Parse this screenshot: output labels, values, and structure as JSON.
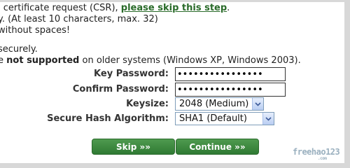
{
  "intro": {
    "line1_prefix": "l certificate request (CSR), ",
    "skip_link": "please skip this step",
    "line1_suffix": ".",
    "line2": "y. (At least 10 characters, max. 32)",
    "line3": "without spaces!",
    "line4": "securely.",
    "line5_prefix": "e ",
    "line5_bold": "not supported",
    "line5_suffix": " on older systems (Windows XP, Windows 2003)."
  },
  "form": {
    "key_password_label": "Key Password:",
    "key_password_value": "••••••••••••••••",
    "confirm_password_label": "Confirm Password:",
    "confirm_password_value": "••••••••••••••••",
    "keysize_label": "Keysize:",
    "keysize_value": "2048 (Medium)",
    "hash_label": "Secure Hash Algorithm:",
    "hash_value": "SHA1 (Default)"
  },
  "buttons": {
    "skip": "Skip »»",
    "continue": "Continue »»"
  },
  "watermark": {
    "text": "freehao123",
    "sub": ".com"
  },
  "colors": {
    "button_green": "#3a8a3e",
    "link_green": "#2a6b2a",
    "select_border": "#7f9db9"
  }
}
